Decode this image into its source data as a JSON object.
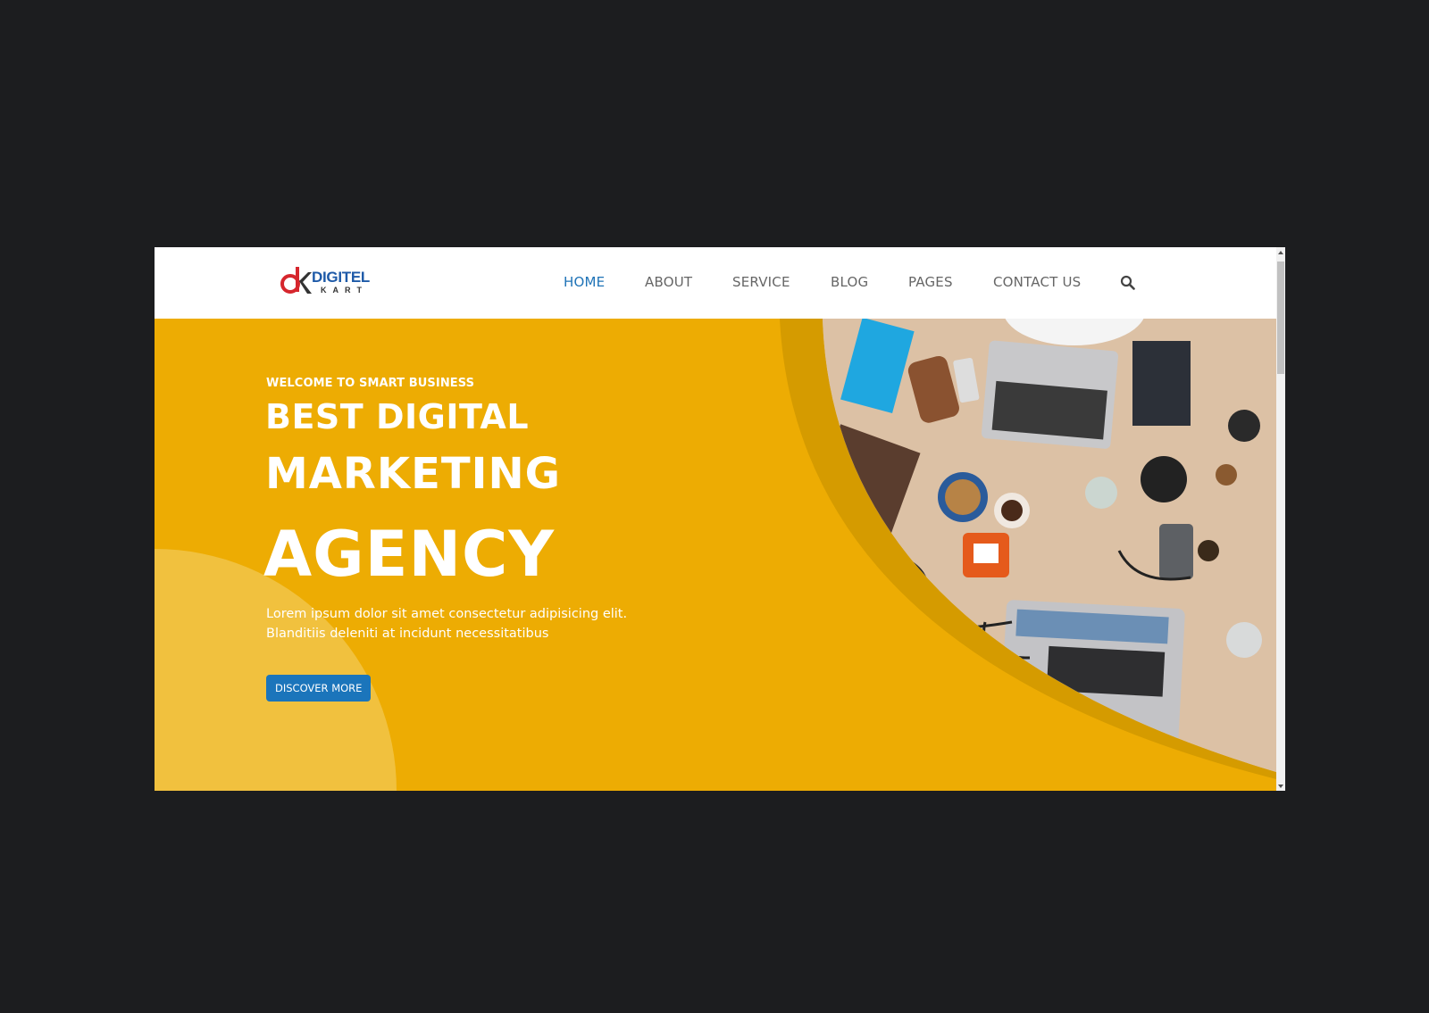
{
  "logo": {
    "mark_text": "dk",
    "word1": "DIGITEL",
    "word2": "KART"
  },
  "nav": {
    "items": [
      {
        "label": "HOME",
        "active": true
      },
      {
        "label": "ABOUT",
        "active": false
      },
      {
        "label": "SERVICE",
        "active": false
      },
      {
        "label": "BLOG",
        "active": false
      },
      {
        "label": "PAGES",
        "active": false
      },
      {
        "label": "CONTACT US",
        "active": false
      }
    ],
    "search_icon": "search-icon"
  },
  "hero": {
    "welcome": "WELCOME TO SMART BUSINESS",
    "line1": "BEST DIGITAL",
    "line2": "MARKETING",
    "line3": "AGENCY",
    "description": "Lorem ipsum dolor sit amet consectetur adipisicing elit. Blanditiis deleniti at incidunt necessitatibus",
    "button_label": "DISCOVER MORE",
    "image": "desk-with-laptops-photo"
  },
  "colors": {
    "page_background": "#1c1d1f",
    "hero_yellow": "#edac03",
    "hero_dark_yellow": "#d59b00",
    "nav_active": "#1f73b7",
    "button_blue": "#1b75bb"
  }
}
